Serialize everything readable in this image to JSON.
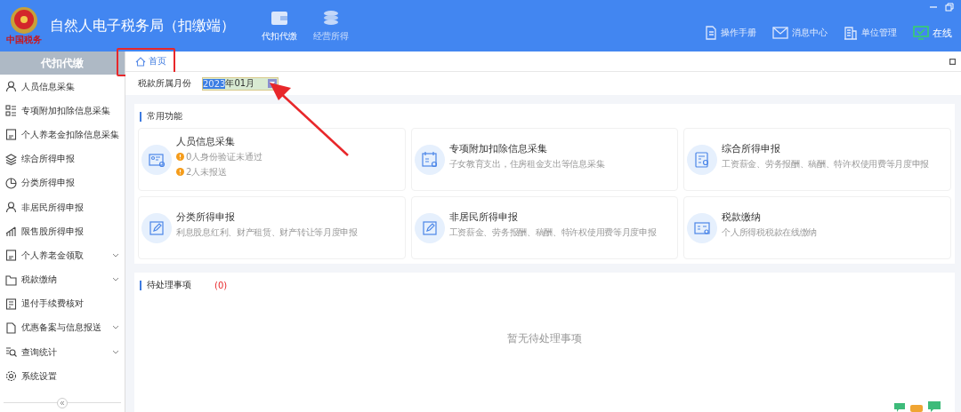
{
  "header": {
    "title": "自然人电子税务局（扣缴端）",
    "logo_caption": "中国税务",
    "nav": [
      {
        "label": "代扣代缴",
        "kind": "wallet",
        "selected": true
      },
      {
        "label": "经营所得",
        "kind": "coins",
        "selected": false
      }
    ],
    "tools": [
      {
        "label": "操作手册",
        "kind": "doc"
      },
      {
        "label": "消息中心",
        "kind": "mail"
      },
      {
        "label": "单位管理",
        "kind": "building"
      },
      {
        "label": "在线",
        "kind": "online"
      }
    ]
  },
  "sidebar": {
    "title": "代扣代缴",
    "items": [
      {
        "label": "人员信息采集",
        "kind": "person"
      },
      {
        "label": "专项附加扣除信息采集",
        "kind": "grid"
      },
      {
        "label": "个人养老金扣除信息采集",
        "kind": "card"
      },
      {
        "label": "综合所得申报",
        "kind": "layers"
      },
      {
        "label": "分类所得申报",
        "kind": "pie"
      },
      {
        "label": "非居民所得申报",
        "kind": "person"
      },
      {
        "label": "限售股所得申报",
        "kind": "bars"
      },
      {
        "label": "个人养老金领取",
        "kind": "card",
        "expanded": false
      },
      {
        "label": "税款缴纳",
        "kind": "folder",
        "expanded": false
      },
      {
        "label": "退付手续费核对",
        "kind": "list"
      },
      {
        "label": "优惠备案与信息报送",
        "kind": "page",
        "expanded": false
      },
      {
        "label": "查询统计",
        "kind": "search",
        "expanded": false
      },
      {
        "label": "系统设置",
        "kind": "gear"
      }
    ]
  },
  "tabs": [
    {
      "label": "首页",
      "selected": true
    }
  ],
  "month_filter": {
    "label": "税款所属月份",
    "selected_text": "2023",
    "value_rest": "年01月"
  },
  "common": {
    "title": "常用功能",
    "cards": [
      {
        "title": "人员信息采集",
        "kind": "idcard",
        "notes": [
          "0人身份验证未通过",
          "2人未报送"
        ]
      },
      {
        "title": "专项附加扣除信息采集",
        "kind": "calendar",
        "description": "子女教育支出，住房租金支出等信息采集"
      },
      {
        "title": "综合所得申报",
        "kind": "form",
        "description": "工资薪金、劳务报酬、稿酬、特许权使用费等月度申报"
      },
      {
        "title": "分类所得申报",
        "kind": "edit",
        "description": "利息股息红利、财产租赁、财产转让等月度申报"
      },
      {
        "title": "非居民所得申报",
        "kind": "edit",
        "description": "工资薪金、劳务报酬、稿酬、特许权使用费等月度申报"
      },
      {
        "title": "税款缴纳",
        "kind": "bill",
        "description": "个人所得税税款在线缴纳"
      }
    ]
  },
  "pending": {
    "title": "待处理事项",
    "count": "(0)",
    "empty_text": "暂无待处理事项"
  }
}
